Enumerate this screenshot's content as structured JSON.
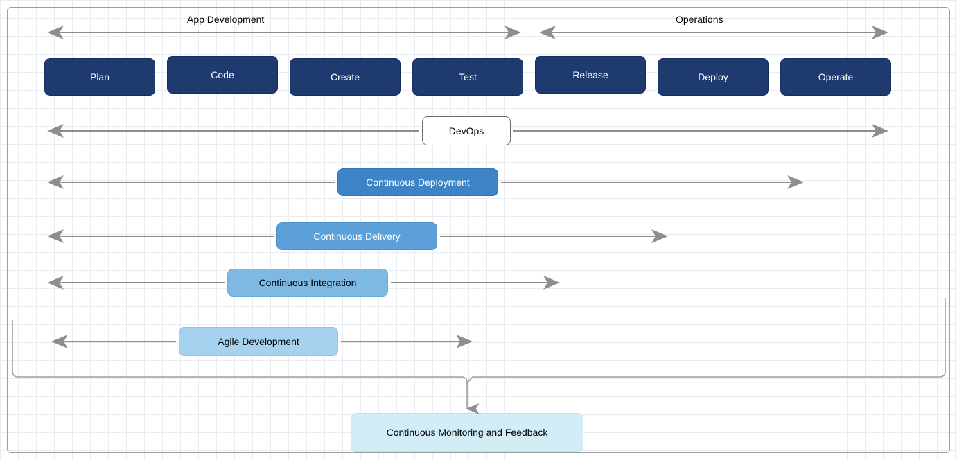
{
  "headers": {
    "app_dev": "App Development",
    "operations": "Operations"
  },
  "stages": {
    "plan": "Plan",
    "code": "Code",
    "create": "Create",
    "test": "Test",
    "release": "Release",
    "deploy": "Deploy",
    "operate": "Operate"
  },
  "rows": {
    "devops": "DevOps",
    "cd": "Continuous Deployment",
    "cdel": "Continuous Delivery",
    "ci": "Continuous Integration",
    "agile": "Agile Development",
    "mon": "Continuous Monitoring and Feedback"
  },
  "chart_data": {
    "type": "diagram",
    "description": "DevOps practices span across the seven lifecycle stages. Left-to-right arrows with stage boxes indicate which stages each practice covers.",
    "top_groups": [
      {
        "name": "App Development",
        "stages": [
          "Plan",
          "Code",
          "Create",
          "Test"
        ]
      },
      {
        "name": "Operations",
        "stages": [
          "Release",
          "Deploy",
          "Operate"
        ]
      }
    ],
    "lifecycle_stages": [
      "Plan",
      "Code",
      "Create",
      "Test",
      "Release",
      "Deploy",
      "Operate"
    ],
    "practices": [
      {
        "name": "DevOps",
        "from_stage": "Plan",
        "to_stage": "Operate"
      },
      {
        "name": "Continuous Deployment",
        "from_stage": "Plan",
        "to_stage": "Deploy"
      },
      {
        "name": "Continuous Delivery",
        "from_stage": "Plan",
        "to_stage": "Release"
      },
      {
        "name": "Continuous Integration",
        "from_stage": "Plan",
        "to_stage": "Test"
      },
      {
        "name": "Agile Development",
        "from_stage": "Plan",
        "to_stage": "Create"
      }
    ],
    "feedback_node": "Continuous Monitoring and Feedback",
    "feedback_bracket": "spans entire lifecycle and feeds into Continuous Monitoring and Feedback"
  }
}
